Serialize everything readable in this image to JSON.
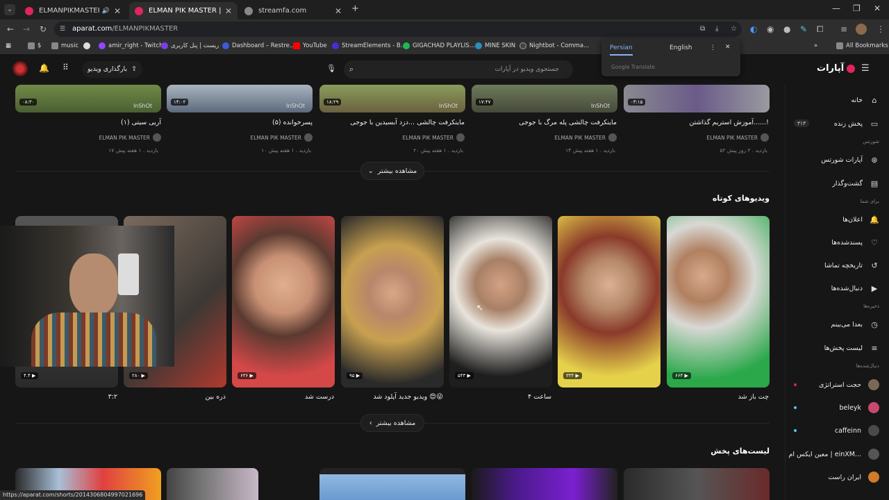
{
  "tabs": [
    {
      "title": "ELMANPIKMASTER پخش زنده"
    },
    {
      "title": "ELMAN PIK MASTER | آپارات"
    },
    {
      "title": "streamfa.com"
    }
  ],
  "window_controls": {
    "minimize": "—",
    "maximize": "❐",
    "close": "✕"
  },
  "omnibox": {
    "host": "aparat.com",
    "path": "/ELMANPIKMASTER"
  },
  "bookmarks": [
    {
      "label": "$",
      "color": "#888"
    },
    {
      "label": "music",
      "color": "#888"
    },
    {
      "label": "amir_right - Twitch",
      "color": "#9146ff"
    },
    {
      "label": "ریست | پنل کاربری",
      "color": "#7b3fe4"
    },
    {
      "label": "Dashboard – Restre...",
      "color": "#3b5bdb"
    },
    {
      "label": "YouTube",
      "color": "#ff0000"
    },
    {
      "label": "StreamElements - B...",
      "color": "#4c2bd6"
    },
    {
      "label": "GIGACHAD PLAYLIS...",
      "color": "#1db954"
    },
    {
      "label": "MINE SKIN",
      "color": "#2b8cbe"
    },
    {
      "label": "Nightbot - Comma...",
      "color": "#222"
    },
    {
      "label": "All Bookmarks",
      "color": "#888"
    }
  ],
  "translate": {
    "lang_from": "Persian",
    "lang_to": "English",
    "brand": "Google Translate"
  },
  "header": {
    "upload_label": "بارگذاری ویدیو",
    "search_placeholder": "جستجوی ویدیو در آپارات",
    "logo": "آپارات"
  },
  "top_videos": [
    {
      "title": "آریی سیتی (۱)",
      "channel": "ELMAN PIK MASTER",
      "meta": "۱۷ بازدید . ۱ هفته پیش",
      "duration": "۰۸:۳۰"
    },
    {
      "title": "پسرخوانده (۵)",
      "channel": "ELMAN PIK MASTER",
      "meta": "۱۰ بازدید . ۱ هفته پیش",
      "duration": "۱۴:۰۲"
    },
    {
      "title": "ماینکرفت چالشی ...دزد آبسیدین با جوجی",
      "channel": "ELMAN PIK MASTER",
      "meta": "۲۰ بازدید . ۱ هفته پیش",
      "duration": "۱۸:۲۹"
    },
    {
      "title": "ماینکرفت چالشی پله مرگ با جوجی",
      "channel": "ELMAN PIK MASTER",
      "meta": "۱۴ بازدید . ۱ هفته پیش",
      "duration": "۱۷:۴۷"
    },
    {
      "title": "آموزش استریم گذاشتن......!",
      "channel": "ELMAN PIK MASTER",
      "meta": "۵۲ بازدید . ۲ روز پیش",
      "duration": "۰۳:۱۵"
    }
  ],
  "watermark": "InShOt",
  "more_label": "مشاهده بیشتر",
  "shorts_heading": "ویدیوهای کوتاه",
  "shorts": [
    {
      "title": "۳:۲",
      "views": "۴.۴"
    },
    {
      "title": "ذره بین",
      "views": "۲۸۰"
    },
    {
      "title": "درست شد",
      "views": "۶۳۶"
    },
    {
      "title": "ویدیو جدید آپلود شد 😍😜",
      "views": "۹۵"
    },
    {
      "title": "ساعت ۴",
      "views": "۵۴۳"
    },
    {
      "title": "",
      "views": "۳۳۴"
    },
    {
      "title": "چت باز شد",
      "views": "۶۶۴"
    }
  ],
  "playlists_heading": "لیست‌های پخش",
  "sidebar": {
    "home": "خانه",
    "live": "پخش زنده",
    "live_count": "۳۱۳",
    "shorts_section": "شورتس",
    "aparat_shorts": "آپارات شورتس",
    "explore": "گشت‌وگذار",
    "for_you": "برای شما",
    "notifications": "اعلان‌ها",
    "liked": "پسندشده‌ها",
    "history": "تاریخچه تماشا",
    "following": "دنبال‌شده‌ها",
    "saved": "ذخیره‌ها",
    "watch_later": "بعدا می‌بینم",
    "playlists": "لیست پخش‌ها",
    "followed": "دنبال‌شده‌ها",
    "channels": [
      {
        "name": "حجت استراتژی",
        "color": "#7a6a55"
      },
      {
        "name": "beleyk",
        "color": "#c74a6e"
      },
      {
        "name": "caffeinn",
        "color": "#4a4a4a"
      },
      {
        "name": "معین ایکس ام | einXM...",
        "color": "#555"
      },
      {
        "name": "ایران راست",
        "color": "#d07a2a"
      }
    ]
  },
  "status_url": "https://aparat.com/shorts/2014306804997021696"
}
